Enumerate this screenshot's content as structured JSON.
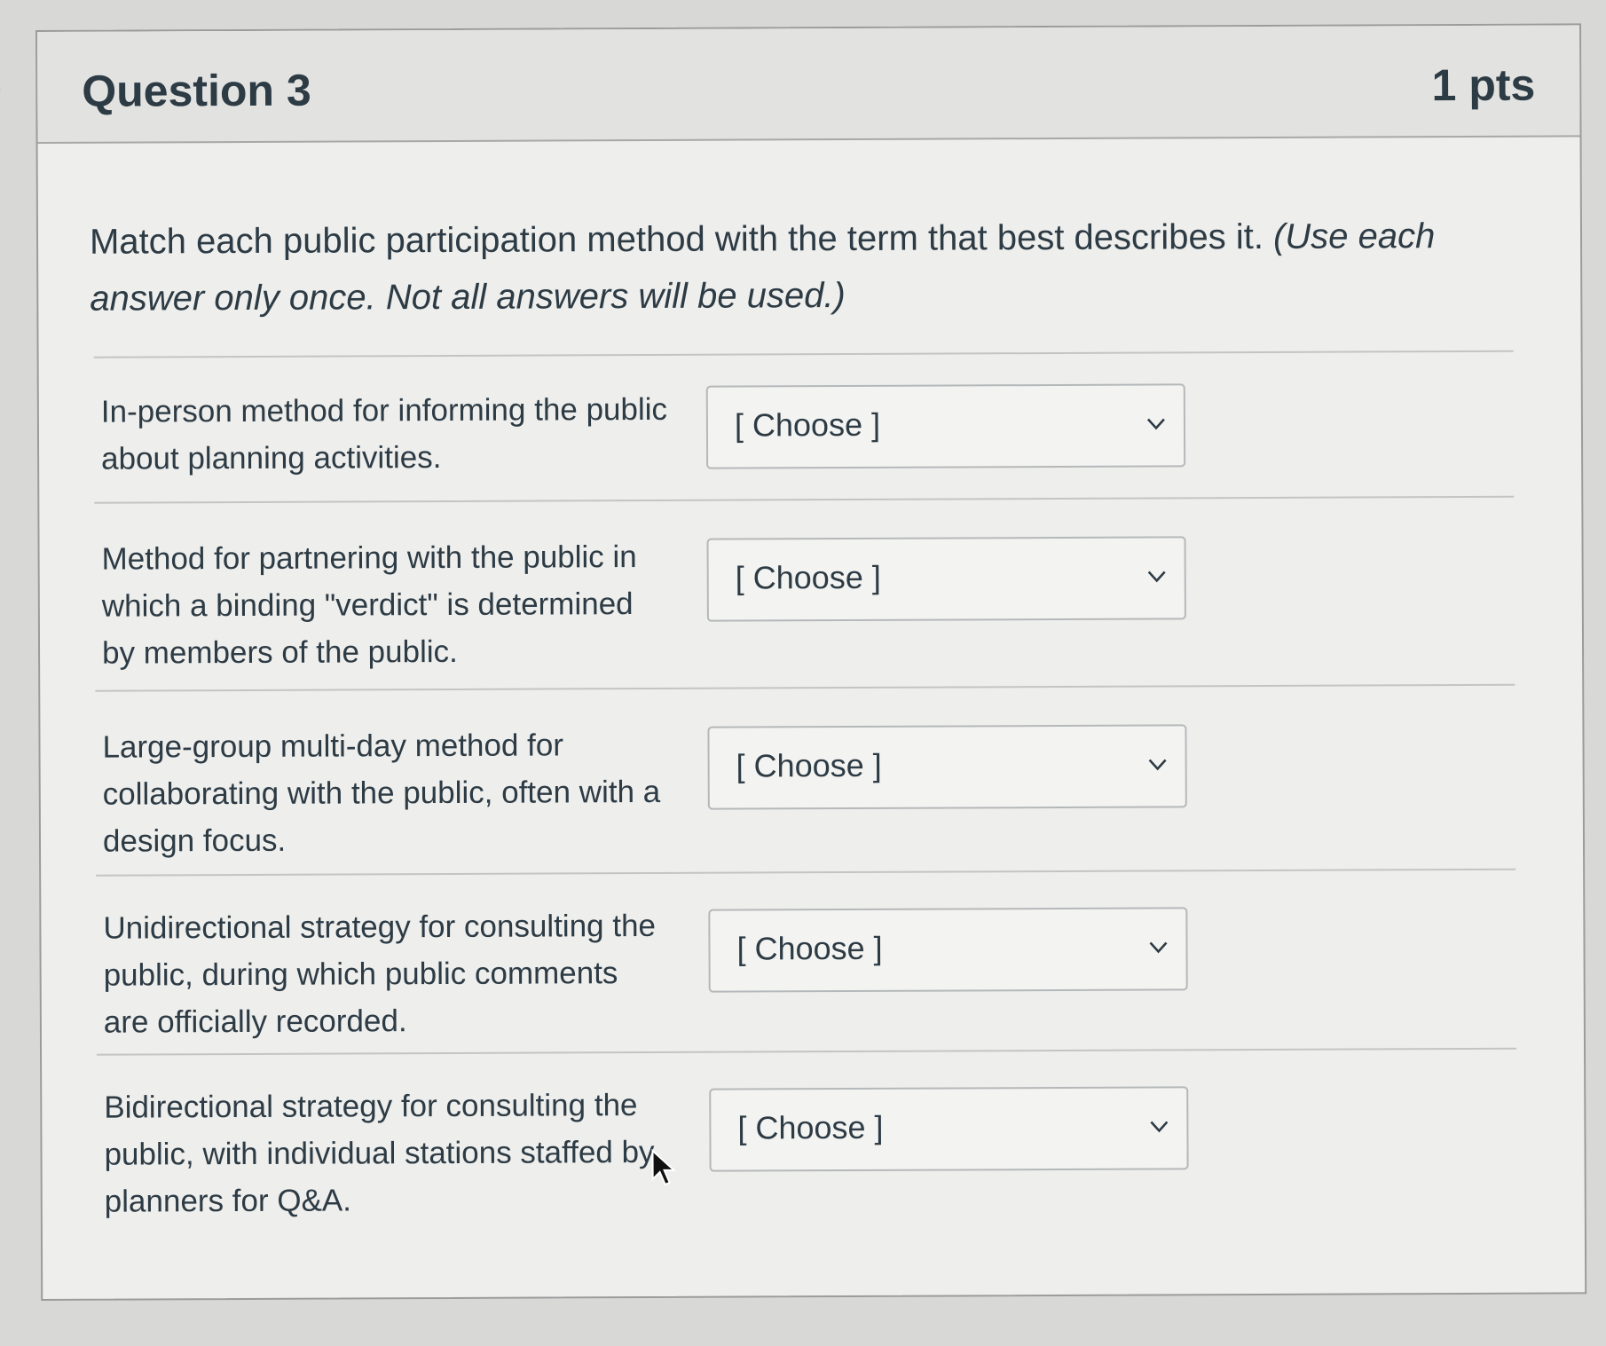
{
  "question": {
    "title": "Question 3",
    "points": "1 pts",
    "prompt_plain": "Match each public participation method with the term that best describes it.",
    "prompt_italic": "(Use each answer only once.  Not all answers will be used.)"
  },
  "rows": [
    {
      "label": "In-person method for informing the public about planning activities.",
      "selected": "[ Choose ]"
    },
    {
      "label": "Method for partnering with the public in which a binding \"verdict\" is determined by members of the public.",
      "selected": "[ Choose ]"
    },
    {
      "label": "Large-group multi-day method for collaborating with the public, often with a design focus.",
      "selected": "[ Choose ]"
    },
    {
      "label": "Unidirectional strategy for consulting the public, during which public comments are officially recorded.",
      "selected": "[ Choose ]"
    },
    {
      "label": "Bidirectional strategy for consulting the public, with individual stations staffed by planners for Q&A.",
      "selected": "[ Choose ]"
    }
  ],
  "icons": {
    "collapse": "chevron-right-icon",
    "dropdown": "chevron-down-icon",
    "cursor": "mouse-pointer-icon"
  },
  "colors": {
    "text": "#2d3b45",
    "card_background": "#eeeeec",
    "header_background": "#e2e2e0",
    "border": "#9a9c9c"
  }
}
